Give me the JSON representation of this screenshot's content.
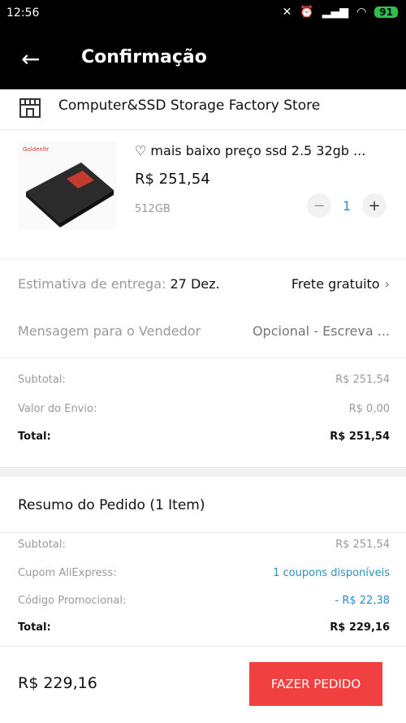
{
  "status_bar": {
    "time": "12:56",
    "battery": "91"
  },
  "app_bar": {
    "title": "Confirmação"
  },
  "store": {
    "name": "Computer&SSD Storage Factory Store"
  },
  "product": {
    "title": "♡ mais baixo preço ssd 2.5 32gb ...",
    "price": "R$ 251,54",
    "variant": "512GB",
    "quantity": "1",
    "brand_text": "Goldenfir"
  },
  "delivery": {
    "label": "Estimativa de entrega:",
    "date": "27 Dez.",
    "shipping": "Frete gratuito"
  },
  "message": {
    "label": "Mensagem para o Vendedor",
    "placeholder": "Opcional - Escreva ..."
  },
  "store_totals": [
    {
      "label": "Subtotal:",
      "value": "R$ 251,54"
    },
    {
      "label": "Valor do Envio:",
      "value": "R$ 0,00"
    },
    {
      "label": "Total:",
      "value": "R$ 251,54"
    }
  ],
  "order_summary": {
    "title": "Resumo do Pedido (1 Item)",
    "rows": [
      {
        "label": "Subtotal:",
        "value": "R$ 251,54"
      },
      {
        "label": "Cupom AliExpress:",
        "value": "1 coupons disponíveis"
      },
      {
        "label": "Código Promocional:",
        "value": "- R$ 22,38"
      },
      {
        "label": "Total:",
        "value": "R$ 229,16"
      }
    ]
  },
  "footer": {
    "total": "R$ 229,16",
    "order_button": "FAZER PEDIDO"
  },
  "colors": {
    "accent": "#f04040",
    "link": "#2a8fbf",
    "header": "#000000"
  }
}
